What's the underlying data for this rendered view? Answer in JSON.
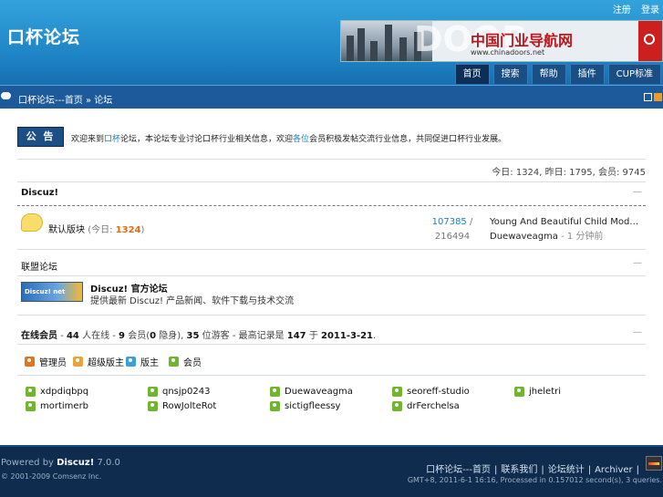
{
  "header": {
    "logo": "口杯论坛",
    "top_links": [
      "注册",
      "登录"
    ],
    "banner": {
      "title": "中国门业导航网",
      "url": "www.chinadoors.net",
      "watermark": "DOOR"
    },
    "tabs": [
      "首页",
      "搜索",
      "帮助",
      "插件",
      "CUP标准"
    ]
  },
  "navbar": {
    "breadcrumb": "口杯论坛---首页 » 论坛"
  },
  "notice": {
    "button": "公 告",
    "text_a": "欢迎来到",
    "text_b": "口杯",
    "text_c": "论坛，本论坛专业讨论口杯行业相关信息，欢迎",
    "text_d": "各位",
    "text_e": "会员积极发帖交流行业信息，共同促进口杯行业发展。"
  },
  "stats": "今日: 1324, 昨日: 1795, 会员: 9745",
  "forum_group": {
    "title": "Discuz!",
    "collapse": "—",
    "forum": {
      "name": "默认版块",
      "today_label": "今日",
      "today_count": "1324",
      "threads": "107385",
      "sep": "/",
      "posts": "216494",
      "last_title": "Young And Beautiful Child Mode ...",
      "last_author": "Duewaveagma",
      "last_time": "- 1 分钟前"
    }
  },
  "links": {
    "title": "联盟论坛",
    "collapse": "—",
    "logo_text": "Discuz! net",
    "site_name": "Discuz! 官方论坛",
    "site_desc": "提供最新 Discuz! 产品新闻、软件下载与技术交流"
  },
  "online": {
    "label": "在线会员",
    "total": "44",
    "members": "9",
    "invisible": "0",
    "guests": "35",
    "record": "147",
    "record_date": "2011-3-21",
    "collapse": "—",
    "legend": [
      "管理员",
      "超级版主",
      "版主",
      "会员"
    ],
    "users": [
      "xdpdiqbpq",
      "qnsjp0243",
      "Duewaveagma",
      "seoreff-studio",
      "jheletri",
      "mortimerb",
      "RowJolteRot",
      "sictigfleessy",
      "drFerchelsa"
    ]
  },
  "footer": {
    "powered_prefix": "Powered by",
    "powered_brand": "Discuz!",
    "powered_version": "7.0.0",
    "copyright": "© 2001-2009 Comsenz Inc.",
    "links": [
      "口杯论坛---首页",
      "联系我们",
      "论坛统计",
      "Archiver"
    ],
    "info": "GMT+8, 2011-6-1 16:16, Processed in 0.157012 second(s), 3 queries."
  },
  "colors": {
    "header_blue": "#1d82c4",
    "navbar_blue": "#1d5a9b",
    "footer_navy": "#0f2c4f",
    "link_blue": "#1b7fc6",
    "highlight_orange": "#e96a12"
  }
}
